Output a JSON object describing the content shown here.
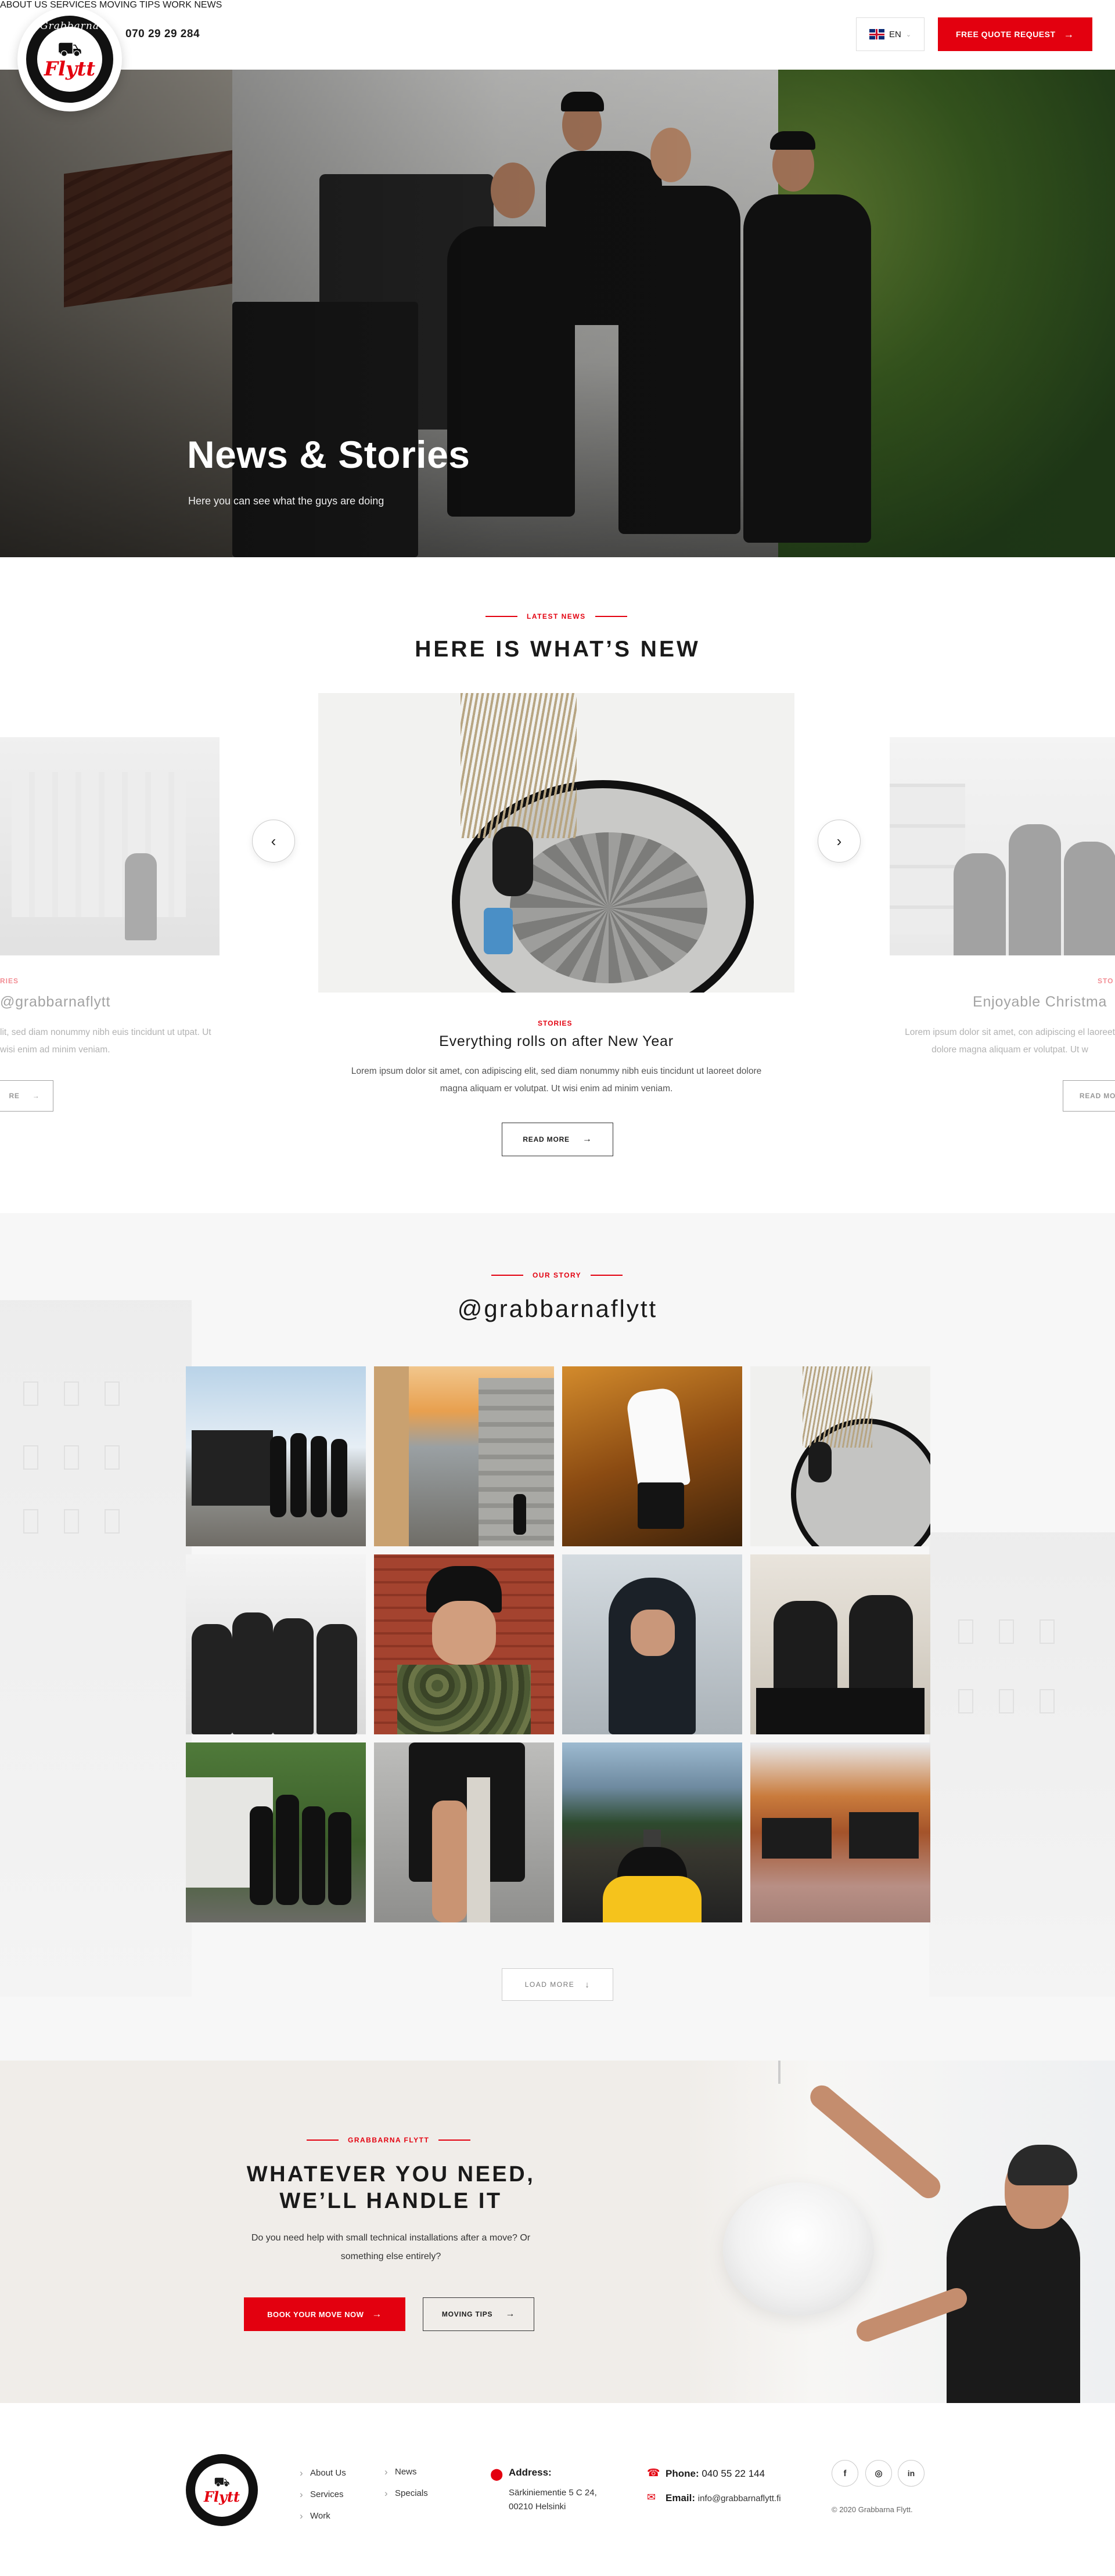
{
  "header": {
    "logo_top": "Grabbarna",
    "logo_word": "Flytt",
    "phone": "070 29 29 284",
    "nav": [
      "ABOUT US",
      "SERVICES",
      "MOVING TIPS",
      "WORK",
      "NEWS"
    ],
    "lang": "EN",
    "cta": "FREE QUOTE REQUEST"
  },
  "hero": {
    "title": "News & Stories",
    "subtitle": "Here you can see what the guys are doing"
  },
  "news": {
    "label": "LATEST NEWS",
    "title": "HERE IS WHAT’S NEW",
    "left_card": {
      "category": "RIES",
      "title": "@grabbarnaflytt",
      "text": "lit, sed diam nonummy nibh euis tincidunt ut utpat. Ut wisi enim ad minim veniam.",
      "button": "RE"
    },
    "center_card": {
      "category": "STORIES",
      "title": "Everything rolls on after New Year",
      "text": "Lorem ipsum dolor sit amet, con adipiscing elit, sed diam nonummy nibh euis tincidunt ut laoreet dolore magna aliquam er volutpat. Ut wisi enim ad minim veniam.",
      "button": "READ MORE"
    },
    "right_card": {
      "category": "STO",
      "title": "Enjoyable Christma",
      "text": "Lorem ipsum dolor sit amet, con adipiscing el laoreet dolore magna aliquam er volutpat. Ut w",
      "button": "READ MO"
    }
  },
  "instagram": {
    "label": "OUR STORY",
    "title": "@grabbarnaflytt",
    "load_more": "LOAD MORE"
  },
  "cta": {
    "label": "GRABBARNA FLYTT",
    "title_line1": "WHATEVER YOU NEED,",
    "title_line2": "WE’LL HANDLE IT",
    "text": "Do you need help with small technical installations after a move? Or something else entirely?",
    "primary": "BOOK YOUR MOVE NOW",
    "secondary": "MOVING TIPS"
  },
  "footer": {
    "links_col1": [
      "About Us",
      "Services",
      "Work"
    ],
    "links_col2": [
      "News",
      "Specials"
    ],
    "address_label": "Address:",
    "address_line1": "Särkiniementie 5 C 24,",
    "address_line2": "00210 Helsinki",
    "phone_label": "Phone:",
    "phone": "040 55 22 144",
    "email_label": "Email:",
    "email": "info@grabbarnaflytt.fi",
    "social": [
      "f",
      "◎",
      "in"
    ],
    "copyright": "© 2020 Grabbarna Flytt."
  },
  "colors": {
    "accent": "#e3000f",
    "text": "#1a1a1a"
  }
}
